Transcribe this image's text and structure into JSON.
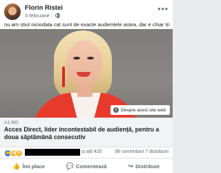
{
  "post": {
    "author": "Florin Ristei",
    "date": "3 februarie",
    "date_separator": "·",
    "caption": "nu am stiut niciodata cat sunt de exacte audientele astea, dar e chiar trist",
    "more_glyph": "•••"
  },
  "image": {
    "about_label": "Despre acest site web",
    "info_glyph": "i"
  },
  "link": {
    "domain": "A1.RO",
    "headline": "Acces Direct, lider incontestabil de audiență, pentru a doua săptămână consecutiv"
  },
  "reactions": {
    "icons": [
      "like-icon",
      "haha-icon",
      "sad-icon"
    ],
    "others_text": "și alți 420",
    "comments": "98 comentarii",
    "shares": "7 distribuiri"
  },
  "actions": {
    "like": "Îmi place",
    "comment": "Comentează",
    "share": "Distribuie"
  },
  "colors": {
    "facebook_blue": "#1877f2",
    "jacket_red": "#e83a2c",
    "text_gray": "#606770"
  }
}
